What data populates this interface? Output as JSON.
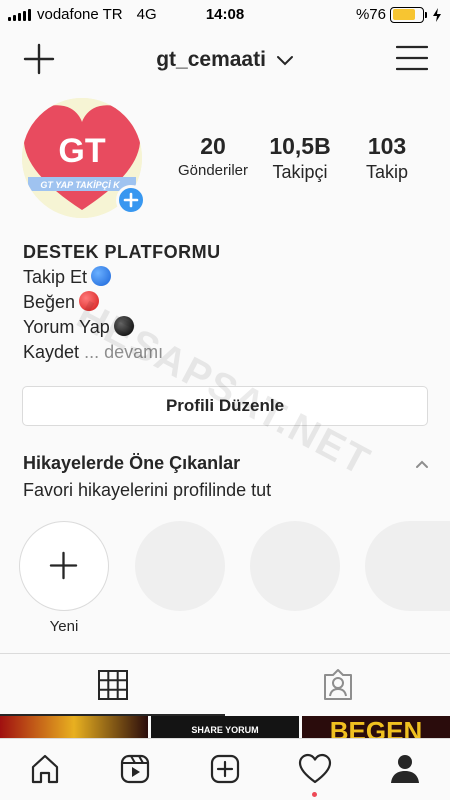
{
  "status_bar": {
    "carrier": "vodafone TR",
    "network": "4G",
    "time": "14:08",
    "battery_percent": "%76",
    "battery_level": 0.76,
    "battery_color": "#f7c531"
  },
  "header": {
    "username": "gt_cemaati",
    "left_icon": "plus-icon",
    "right_icon": "menu-icon"
  },
  "profile": {
    "avatar_text": "GT",
    "avatar_banner": "GT YAP TAKİPÇİ K",
    "stats": [
      {
        "value": "20",
        "label": "Gönderiler"
      },
      {
        "value": "10,5B",
        "label": "Takipçi"
      },
      {
        "value": "103",
        "label": "Takip"
      }
    ],
    "bio": {
      "name": "DESTEK PLATFORMU",
      "lines": [
        "Takip Et",
        "Beğen",
        "Yorum Yap",
        "Kaydet"
      ],
      "more": "... devamı"
    },
    "edit_button": "Profili Düzenle"
  },
  "highlights": {
    "title": "Hikayelerde Öne Çıkanlar",
    "subtitle": "Favori hikayelerini profilinde tut",
    "new_label": "Yeni"
  },
  "watermark": "HESAPSAT.NET",
  "thumbnails": [
    "",
    "SHARE YORUM",
    "BEGEN"
  ],
  "colors": {
    "accent": "#3897f0",
    "heart": "#e84b5f",
    "notification": "#ed4956"
  }
}
